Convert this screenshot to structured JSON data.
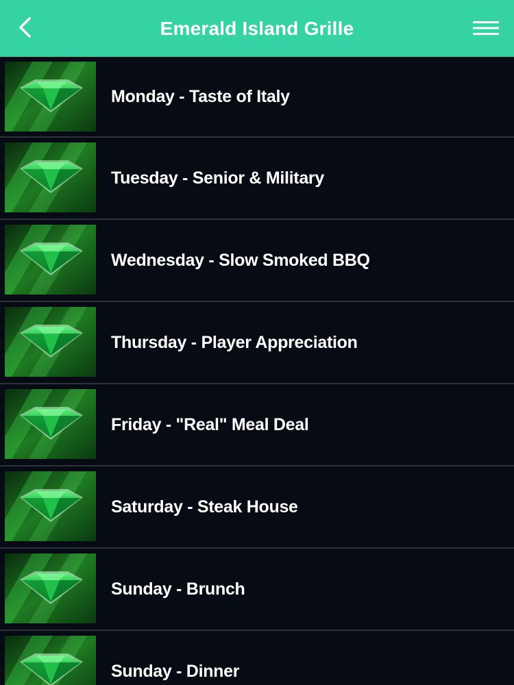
{
  "header": {
    "title": "Emerald Island Grille",
    "back_icon": "chevron-left-icon",
    "menu_icon": "hamburger-menu-icon",
    "bar_color": "#35d3a3"
  },
  "list": {
    "item_icon": "emerald-gem-icon",
    "items": [
      {
        "label": "Monday - Taste of Italy"
      },
      {
        "label": "Tuesday - Senior & Military"
      },
      {
        "label": "Wednesday - Slow Smoked BBQ"
      },
      {
        "label": "Thursday - Player Appreciation"
      },
      {
        "label": "Friday - \"Real\" Meal Deal"
      },
      {
        "label": "Saturday - Steak House"
      },
      {
        "label": "Sunday - Brunch"
      },
      {
        "label": "Sunday - Dinner"
      }
    ]
  }
}
